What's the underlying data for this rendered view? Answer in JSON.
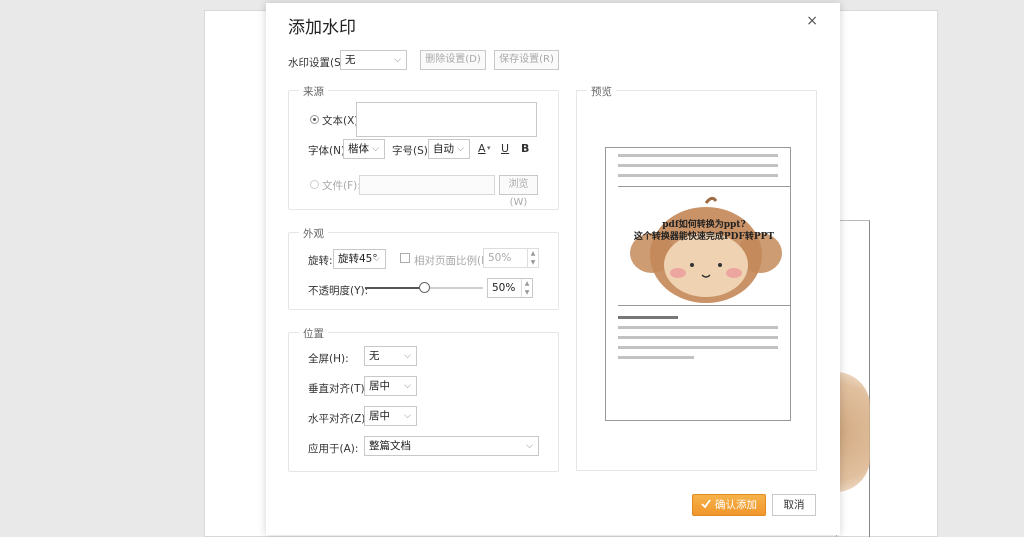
{
  "dialog": {
    "title": "添加水印",
    "close_glyph": "×",
    "preset_label": "水印设置(S):",
    "preset_value": "无",
    "delete_label": "删除设置(D)",
    "save_label": "保存设置(R)"
  },
  "source": {
    "title": "来源",
    "text_label": "文本(X):",
    "text_value": "",
    "font_label": "字体(N):",
    "font_value": "楷体",
    "size_label": "字号(S):",
    "size_value": "自动",
    "font_color_glyph": "A",
    "underline_glyph": "U",
    "bold_glyph": "B",
    "file_label": "文件(F):",
    "file_value": "",
    "browse_label": "浏览(W)"
  },
  "appearance": {
    "title": "外观",
    "rotation_label": "旋转:",
    "rotation_value": "旋转45°",
    "relative_label": "相对页面比例(L):",
    "relative_value": "50%",
    "opacity_label": "不透明度(Y):",
    "opacity_value": "50%",
    "opacity_level": 0.5
  },
  "position": {
    "title": "位置",
    "fullscreen_label": "全屏(H):",
    "fullscreen_value": "无",
    "valign_label": "垂直对齐(T):",
    "valign_value": "居中",
    "halign_label": "水平对齐(Z):",
    "halign_value": "居中",
    "apply_label": "应用于(A):",
    "apply_value": "整篇文档"
  },
  "preview": {
    "title": "预览",
    "watermark_line1": "pdf如何转换为ppt?",
    "watermark_line2": "这个转换器能快速完成PDF转PPT"
  },
  "footer": {
    "confirm_label": "确认添加",
    "cancel_label": "取消"
  },
  "colors": {
    "accent": "#f0962c",
    "panel_border": "#e6e6e6"
  }
}
